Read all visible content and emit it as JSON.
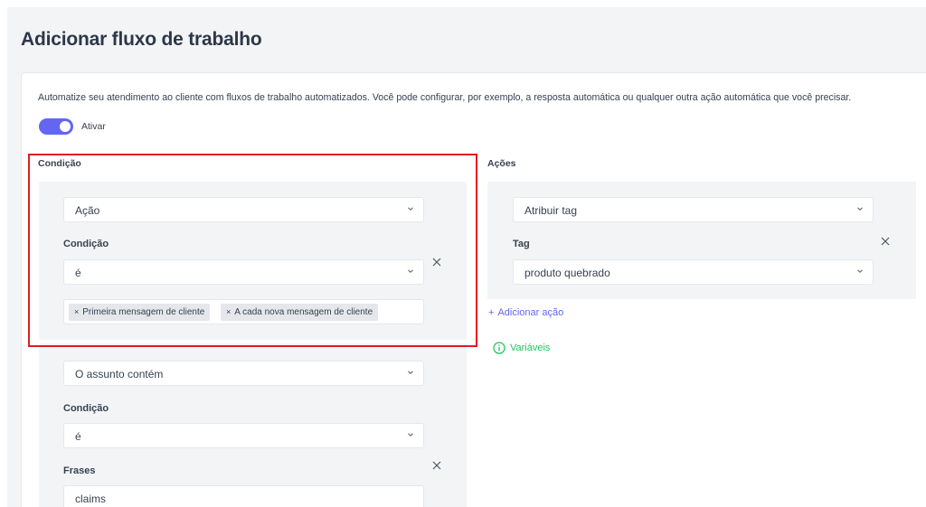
{
  "page": {
    "title": "Adicionar fluxo de trabalho",
    "description": "Automatize seu atendimento ao cliente com fluxos de trabalho automatizados. Você pode configurar, por exemplo, a resposta automática ou qualquer outra ação automática que você precisar.",
    "toggle": {
      "label": "Ativar",
      "on": true
    }
  },
  "conditions": {
    "heading": "Condição",
    "first": {
      "type": "Ação",
      "condition_label": "Condição",
      "condition_value": "é",
      "tags": [
        "Primeira mensagem de cliente",
        "A cada nova mensagem de cliente"
      ]
    },
    "second": {
      "type": "O assunto contém",
      "condition_label": "Condição",
      "condition_value": "é",
      "phrases_label": "Frases",
      "phrases_value": "claims"
    }
  },
  "actions": {
    "heading": "Ações",
    "first": {
      "type": "Atribuir tag",
      "tag_label": "Tag",
      "tag_value": "produto quebrado"
    },
    "add_action": "Adicionar ação",
    "variables": "Variáveis"
  },
  "colors": {
    "accent": "#6366f1",
    "highlight": "#e11d1d",
    "variables": "#22c55e"
  },
  "icons": {
    "dropdown": "chevron-down-icon",
    "remove": "close-icon",
    "info": "info-circle-icon",
    "add": "plus-icon"
  }
}
